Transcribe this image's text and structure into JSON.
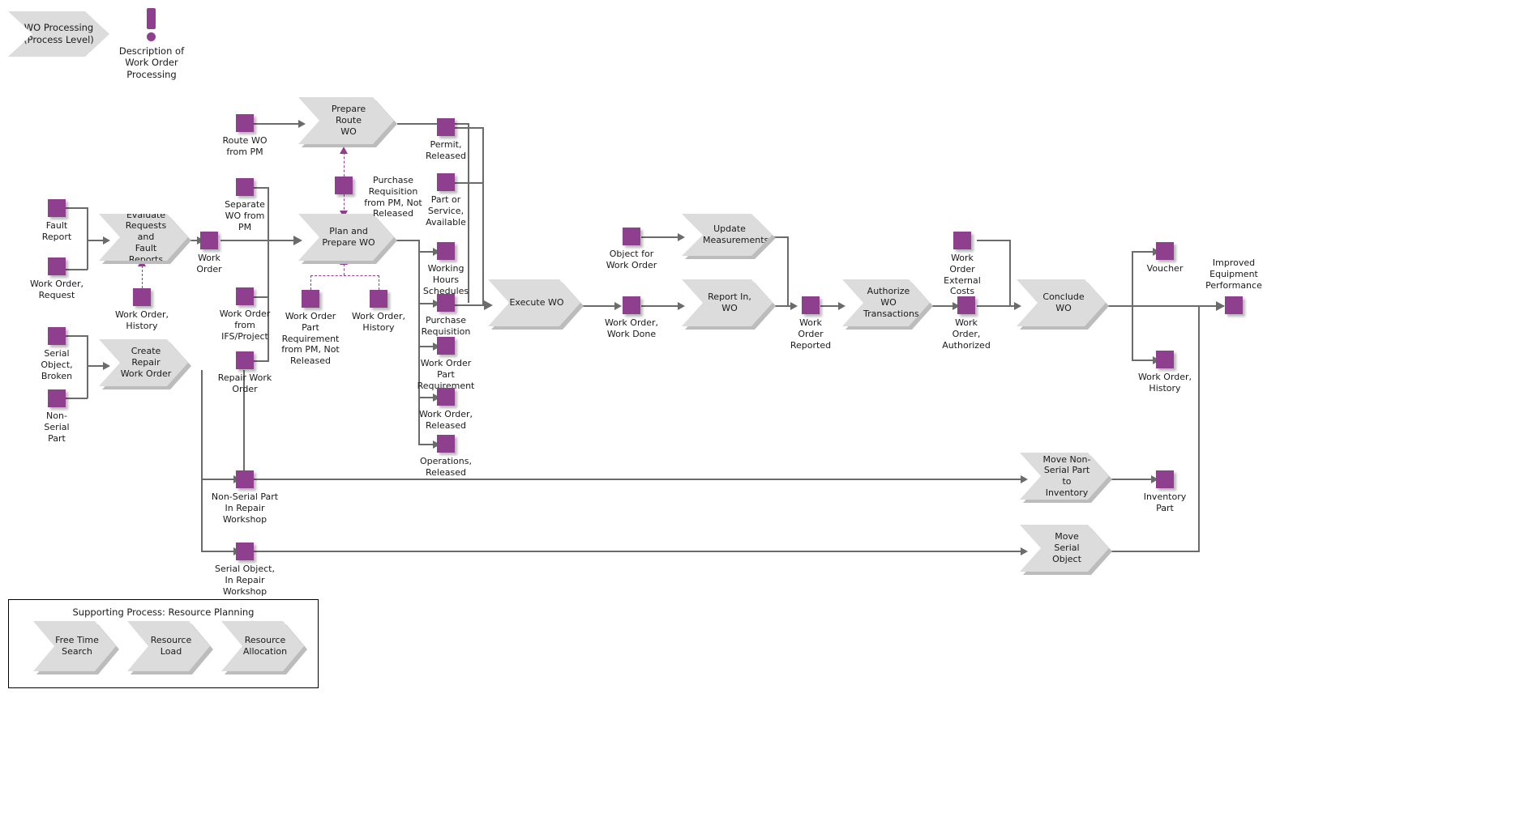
{
  "diagram": {
    "title": "WO  Processing\n(Process Level)",
    "note_text": "Description of\nWork Order\nProcessing",
    "colors": {
      "object": "#8e3f8e",
      "process": "#dcdcdc",
      "connector": "#6b6b6b"
    }
  },
  "processes": {
    "evaluate": "Evaluate\nRequests and\nFault Reports",
    "create_repair": "Create Repair\nWork Order",
    "prepare_route": "Prepare Route\nWO",
    "plan_prepare": "Plan and\nPrepare WO",
    "execute": "Execute WO",
    "update_measurements": "Update\nMeasurements",
    "report_in": "Report In, WO",
    "authorize": "Authorize WO\nTransactions",
    "conclude": "Conclude WO",
    "move_non_serial": "Move Non-\nSerial Part to\nInventory",
    "move_serial": "Move Serial\nObject"
  },
  "objects": {
    "fault_report": "Fault\nReport",
    "wo_request": "Work Order,\nRequest",
    "wo_history_eval": "Work Order,\nHistory",
    "serial_object_broken": "Serial\nObject,\nBroken",
    "non_serial_part": "Non-\nSerial\nPart",
    "work_order": "Work\nOrder",
    "route_wo_from_pm": "Route WO\nfrom PM",
    "separate_wo_from_pm": "Separate\nWO from\nPM",
    "wo_from_ifs_project": "Work Order\nfrom\nIFS/Project",
    "repair_work_order": "Repair Work\nOrder",
    "purchase_req_pm": "Purchase\nRequisition\nfrom PM, Not\nReleased",
    "wo_part_req_pm": "Work Order\nPart\nRequirement\nfrom PM, Not\nReleased",
    "wo_history_plan": "Work Order,\nHistory",
    "permit_released": "Permit,\nReleased",
    "part_or_service": "Part or\nService,\nAvailable",
    "working_hours": "Working\nHours\nSchedules",
    "purchase_requisition": "Purchase\nRequisition",
    "wo_part_requirement": "Work Order\nPart\nRequirement",
    "wo_released": "Work Order,\nReleased",
    "operations_released": "Operations,\nReleased",
    "object_for_wo": "Object for\nWork Order",
    "wo_work_done": "Work Order,\nWork Done",
    "wo_reported": "Work\nOrder\nReported",
    "wo_external_costs": "Work\nOrder\nExternal\nCosts",
    "wo_authorized": "Work\nOrder,\nAuthorized",
    "voucher": "Voucher",
    "wo_history_concl": "Work Order,\nHistory",
    "improved_equipment": "Improved\nEquipment\nPerformance",
    "non_serial_part_repair": "Non-Serial Part\nIn Repair\nWorkshop",
    "serial_object_repair": "Serial Object,\nIn Repair\nWorkshop",
    "inventory_part": "Inventory\nPart"
  },
  "supporting_process": {
    "title": "Supporting Process: Resource Planning",
    "steps": [
      "Free Time\nSearch",
      "Resource Load",
      "Resource\nAllocation"
    ]
  }
}
